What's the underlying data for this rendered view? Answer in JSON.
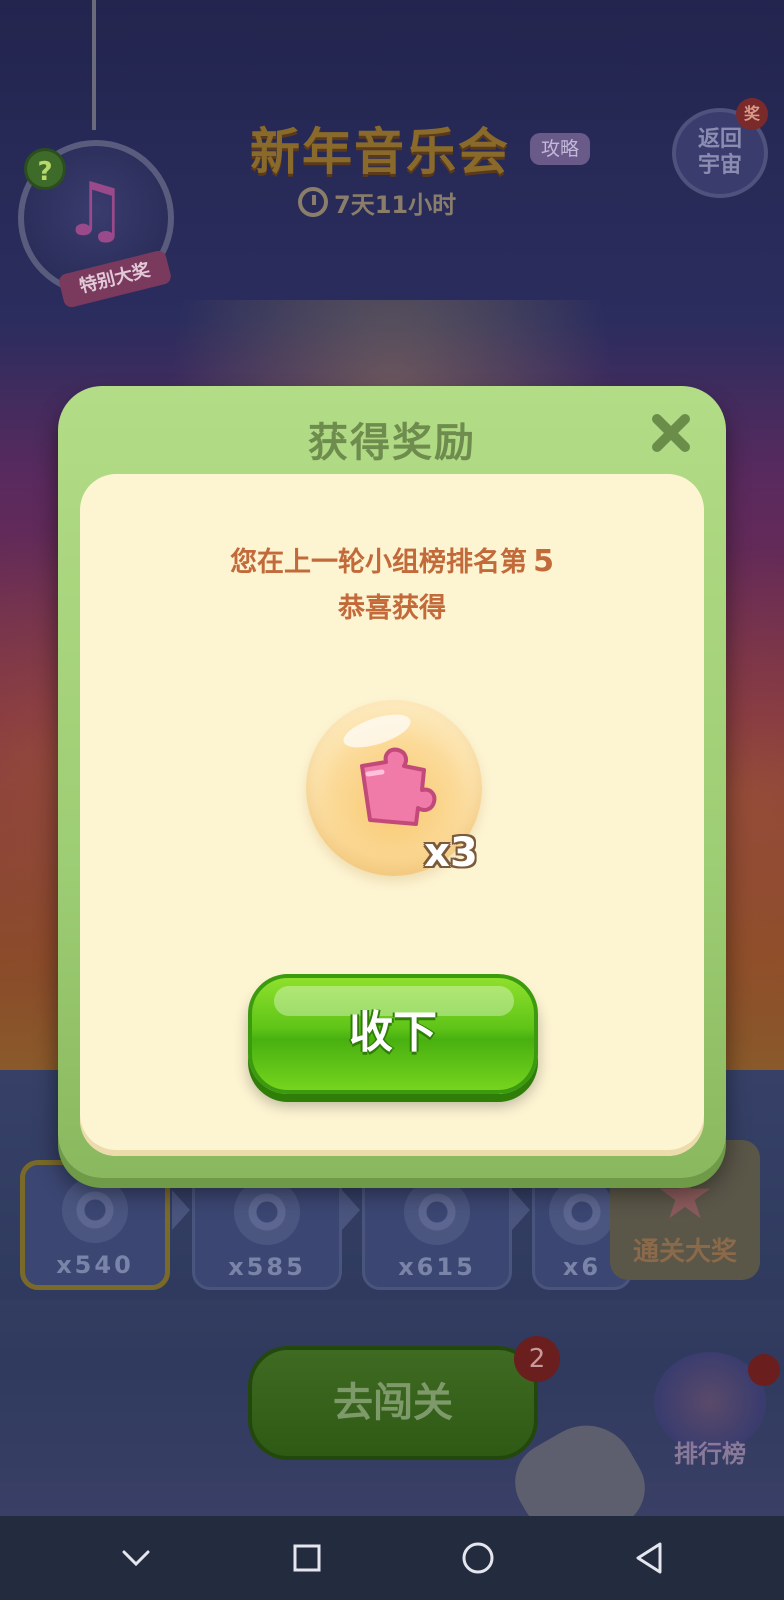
{
  "background": {
    "help_icon": "?",
    "special_prize_label": "特别大奖",
    "event_title": "新年音乐会",
    "guide_label": "攻略",
    "countdown": "7天11小时",
    "return_label": "返回宇宙",
    "return_badge": "奖",
    "levels": [
      {
        "count": "x540"
      },
      {
        "count": "x585"
      },
      {
        "count": "x615"
      },
      {
        "count": "x6"
      }
    ],
    "grand_prize_label": "通关大奖",
    "go_level_label": "去闯关",
    "go_level_badge": "2",
    "ranking_label": "排行榜"
  },
  "modal": {
    "title": "获得奖励",
    "rank_text": "您在上一轮小组榜排名第",
    "rank_number": "5",
    "congrats_text": "恭喜获得",
    "reward": {
      "icon": "puzzle-piece-icon",
      "quantity": "x3"
    },
    "accept_label": "收下"
  },
  "colors": {
    "modal_frame": "#9dcd74",
    "modal_panel": "#fdf4d2",
    "text_accent": "#c26a3a",
    "button_green": "#5fc418",
    "nav_bar": "#232b3f"
  },
  "nav_icons": [
    "chevron-down-icon",
    "square-icon",
    "circle-icon",
    "back-triangle-icon"
  ]
}
